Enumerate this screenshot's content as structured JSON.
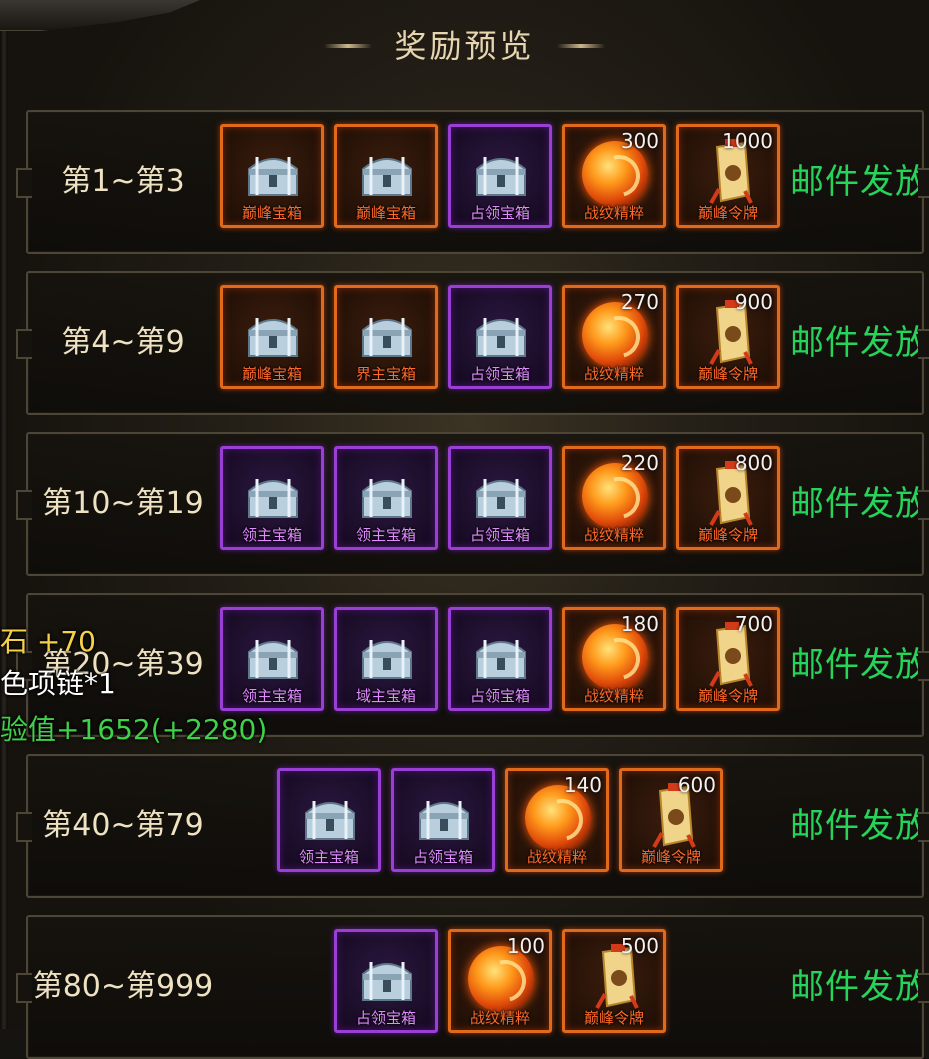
{
  "title": "奖励预览",
  "colors": {
    "mail": "#26d45a",
    "orange_border": "#e06a1c",
    "purple_border": "#9a3fd4"
  },
  "rows": [
    {
      "rank": "第1~第3",
      "reward": "邮件发放",
      "items": [
        {
          "icon": "silver-chest-icon",
          "name": "巅峰宝箱",
          "qty": "",
          "rarity": "orange"
        },
        {
          "icon": "silver-chest-icon",
          "name": "巅峰宝箱",
          "qty": "",
          "rarity": "orange"
        },
        {
          "icon": "silver-chest-icon",
          "name": "占领宝箱",
          "qty": "",
          "rarity": "purple"
        },
        {
          "icon": "fire-orb-icon",
          "name": "战纹精粹",
          "qty": "300",
          "rarity": "orange"
        },
        {
          "icon": "token-icon",
          "name": "巅峰令牌",
          "qty": "1000",
          "rarity": "orange"
        }
      ]
    },
    {
      "rank": "第4~第9",
      "reward": "邮件发放",
      "items": [
        {
          "icon": "silver-chest-icon",
          "name": "巅峰宝箱",
          "qty": "",
          "rarity": "orange"
        },
        {
          "icon": "silver-chest-icon",
          "name": "界主宝箱",
          "qty": "",
          "rarity": "orange"
        },
        {
          "icon": "silver-chest-icon",
          "name": "占领宝箱",
          "qty": "",
          "rarity": "purple"
        },
        {
          "icon": "fire-orb-icon",
          "name": "战纹精粹",
          "qty": "270",
          "rarity": "orange"
        },
        {
          "icon": "token-icon",
          "name": "巅峰令牌",
          "qty": "900",
          "rarity": "orange"
        }
      ]
    },
    {
      "rank": "第10~第19",
      "reward": "邮件发放",
      "items": [
        {
          "icon": "silver-chest-icon",
          "name": "领主宝箱",
          "qty": "",
          "rarity": "purple"
        },
        {
          "icon": "silver-chest-icon",
          "name": "领主宝箱",
          "qty": "",
          "rarity": "purple"
        },
        {
          "icon": "silver-chest-icon",
          "name": "占领宝箱",
          "qty": "",
          "rarity": "purple"
        },
        {
          "icon": "fire-orb-icon",
          "name": "战纹精粹",
          "qty": "220",
          "rarity": "orange"
        },
        {
          "icon": "token-icon",
          "name": "巅峰令牌",
          "qty": "800",
          "rarity": "orange"
        }
      ]
    },
    {
      "rank": "第20~第39",
      "reward": "邮件发放",
      "items": [
        {
          "icon": "silver-chest-icon",
          "name": "领主宝箱",
          "qty": "",
          "rarity": "purple"
        },
        {
          "icon": "silver-chest-icon",
          "name": "域主宝箱",
          "qty": "",
          "rarity": "purple"
        },
        {
          "icon": "silver-chest-icon",
          "name": "占领宝箱",
          "qty": "",
          "rarity": "purple"
        },
        {
          "icon": "fire-orb-icon",
          "name": "战纹精粹",
          "qty": "180",
          "rarity": "orange"
        },
        {
          "icon": "token-icon",
          "name": "巅峰令牌",
          "qty": "700",
          "rarity": "orange"
        }
      ]
    },
    {
      "rank": "第40~第79",
      "reward": "邮件发放",
      "items": [
        {
          "icon": "silver-chest-icon",
          "name": "领主宝箱",
          "qty": "",
          "rarity": "purple"
        },
        {
          "icon": "silver-chest-icon",
          "name": "占领宝箱",
          "qty": "",
          "rarity": "purple"
        },
        {
          "icon": "fire-orb-icon",
          "name": "战纹精粹",
          "qty": "140",
          "rarity": "orange"
        },
        {
          "icon": "token-icon",
          "name": "巅峰令牌",
          "qty": "600",
          "rarity": "orange"
        }
      ]
    },
    {
      "rank": "第80~第999",
      "reward": "邮件发放",
      "items": [
        {
          "icon": "silver-chest-icon",
          "name": "占领宝箱",
          "qty": "",
          "rarity": "purple"
        },
        {
          "icon": "fire-orb-icon",
          "name": "战纹精粹",
          "qty": "100",
          "rarity": "orange"
        },
        {
          "icon": "token-icon",
          "name": "巅峰令牌",
          "qty": "500",
          "rarity": "orange"
        }
      ]
    }
  ],
  "overlay": {
    "line1": "石  +70",
    "line2": "色项链*1",
    "line3": "验值+1652(+2280)"
  }
}
